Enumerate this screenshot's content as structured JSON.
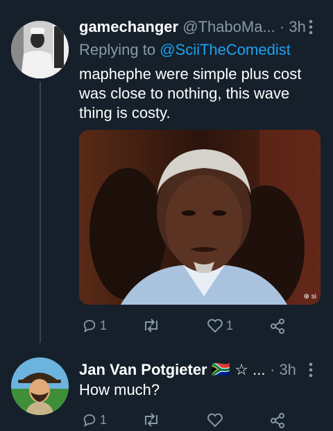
{
  "tweet1": {
    "display_name": "gamechanger",
    "handle": "@ThaboMa...",
    "time": "· 3h",
    "replying_prefix": "Replying to",
    "replying_handle": "@SciiTheComedist",
    "text_lines": [
      "maphephe were simple plus cost",
      "was close to nothing, this wave",
      "thing is costy."
    ],
    "media_watermark": "⊕ si",
    "actions": {
      "reply_count": "1",
      "retweet_count": "",
      "like_count": "1"
    }
  },
  "tweet2": {
    "display_name": "Jan Van Potgieter",
    "name_suffix": "🇿🇦 ☆ ...",
    "time": "· 3h",
    "text": "How much?",
    "actions": {
      "reply_count": "1",
      "retweet_count": "",
      "like_count": ""
    }
  },
  "icons": {
    "menu": "more-vertical-icon",
    "reply": "reply-icon",
    "retweet": "retweet-icon",
    "like": "heart-icon",
    "share": "share-icon"
  },
  "colors": {
    "background": "#15202b",
    "muted": "#8899a6",
    "link": "#1da1f2",
    "thread_line": "#38444d"
  }
}
